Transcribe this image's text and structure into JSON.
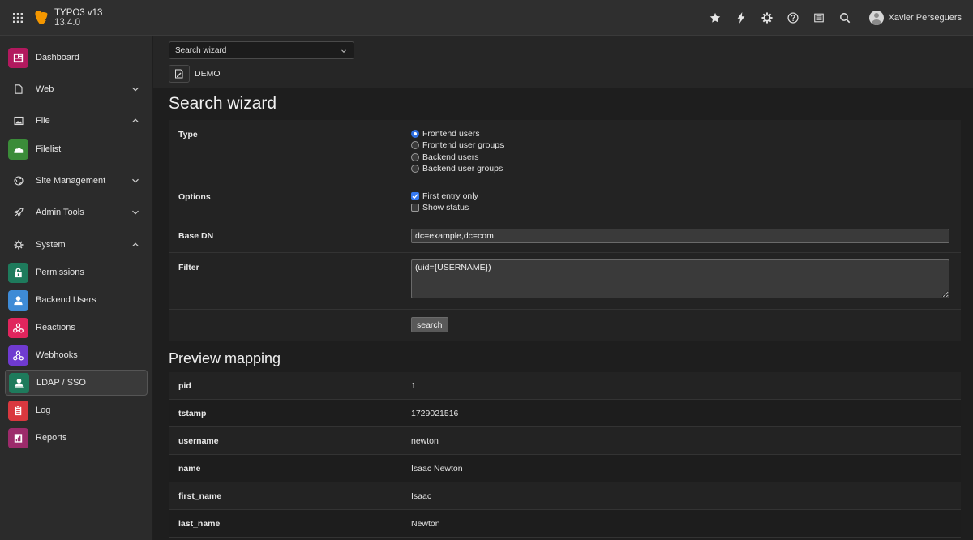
{
  "app": {
    "name": "TYPO3 v13",
    "version": "13.4.0",
    "user": "Xavier Perseguers"
  },
  "topbar_icons": [
    "bookmark-star-icon",
    "flash-clear-cache-icon",
    "settings-gear-icon",
    "help-icon",
    "opendocs-icon",
    "search-icon"
  ],
  "sidebar": {
    "items": [
      {
        "label": "Dashboard",
        "icon": "dashboard-icon",
        "color": "#b2195e"
      },
      {
        "label": "Web",
        "icon": "page-icon"
      },
      {
        "label": "File",
        "icon": "image-icon"
      },
      {
        "label": "Filelist",
        "icon": "filelist-icon",
        "color": "#3b8c39"
      },
      {
        "label": "Site Management",
        "icon": "globe-icon"
      },
      {
        "label": "Admin Tools",
        "icon": "rocket-icon"
      },
      {
        "label": "System",
        "icon": "cog-icon"
      },
      {
        "label": "Permissions",
        "icon": "lock-icon",
        "color": "#1e7b5c"
      },
      {
        "label": "Backend Users",
        "icon": "backend-user-icon",
        "color": "#3e8bd6"
      },
      {
        "label": "Reactions",
        "icon": "reactions-icon",
        "color": "#e0255d"
      },
      {
        "label": "Webhooks",
        "icon": "webhooks-icon",
        "color": "#6f3ad0"
      },
      {
        "label": "LDAP / SSO",
        "icon": "ldap-user-icon",
        "color": "#1e7b5c"
      },
      {
        "label": "Log",
        "icon": "log-icon",
        "color": "#d9383f"
      },
      {
        "label": "Reports",
        "icon": "reports-icon",
        "color": "#9c2b6b"
      }
    ]
  },
  "docheader": {
    "select_value": "Search wizard",
    "breadcrumb": "DEMO"
  },
  "wizard": {
    "title": "Search wizard",
    "type_label": "Type",
    "type_options": [
      "Frontend users",
      "Frontend user groups",
      "Backend users",
      "Backend user groups"
    ],
    "type_selected": "Frontend users",
    "options_label": "Options",
    "option_first": "First entry only",
    "option_first_checked": true,
    "option_status": "Show status",
    "option_status_checked": false,
    "basedn_label": "Base DN",
    "basedn_value": "dc=example,dc=com",
    "filter_label": "Filter",
    "filter_value": "(uid={USERNAME})",
    "search_button": "search"
  },
  "preview": {
    "title": "Preview mapping",
    "rows": [
      {
        "key": "pid",
        "value": "1"
      },
      {
        "key": "tstamp",
        "value": "1729021516"
      },
      {
        "key": "username",
        "value": "newton"
      },
      {
        "key": "name",
        "value": "Isaac Newton"
      },
      {
        "key": "first_name",
        "value": "Isaac"
      },
      {
        "key": "last_name",
        "value": "Newton"
      }
    ]
  }
}
